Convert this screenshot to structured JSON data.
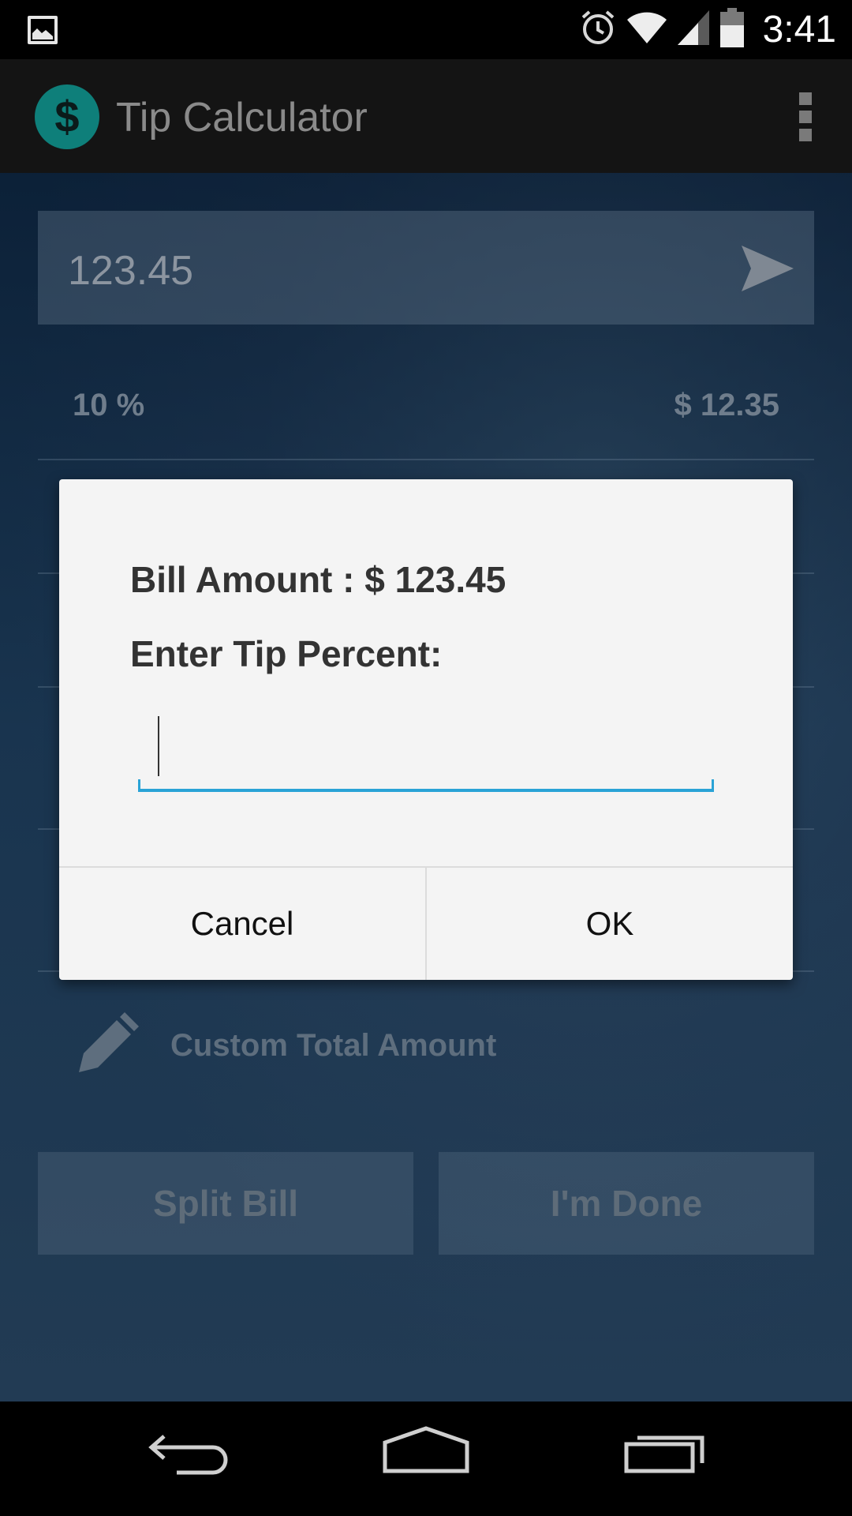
{
  "status_bar": {
    "time": "3:41",
    "icons": [
      "gallery-icon",
      "alarm-icon",
      "wifi-icon",
      "signal-icon",
      "battery-icon"
    ]
  },
  "action_bar": {
    "logo_symbol": "$",
    "title": "Tip Calculator",
    "overflow_icon": "overflow-menu-icon"
  },
  "main": {
    "bill_input_value": "123.45",
    "tip_rows": [
      {
        "percent": "10 %",
        "amount": "$ 12.35"
      }
    ],
    "custom_total_label": "Custom Total Amount",
    "split_bill_label": "Split Bill",
    "done_label": "I'm Done"
  },
  "dialog": {
    "bill_amount_line": "Bill Amount : $ 123.45",
    "prompt": "Enter Tip Percent:",
    "tip_value": "",
    "cancel_label": "Cancel",
    "ok_label": "OK"
  },
  "colors": {
    "accent": "#2aa3d6",
    "logo": "#0e7f7a",
    "dialog_bg": "#f4f4f4"
  }
}
